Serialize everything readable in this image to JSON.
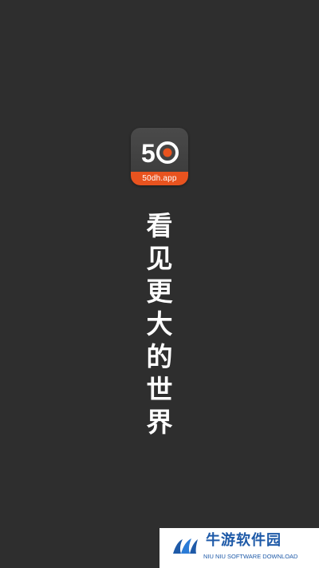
{
  "app_icon": {
    "logo_text": "50",
    "url_label": "50dh.app",
    "accent_color": "#e8531f"
  },
  "slogan": {
    "chars": [
      "看",
      "见",
      "更",
      "大",
      "的",
      "世",
      "界"
    ]
  },
  "watermark": {
    "title": "牛游软件园",
    "subtitle": "NIU NIU SOFTWARE DOWNLOAD",
    "color": "#1e5aa8"
  }
}
